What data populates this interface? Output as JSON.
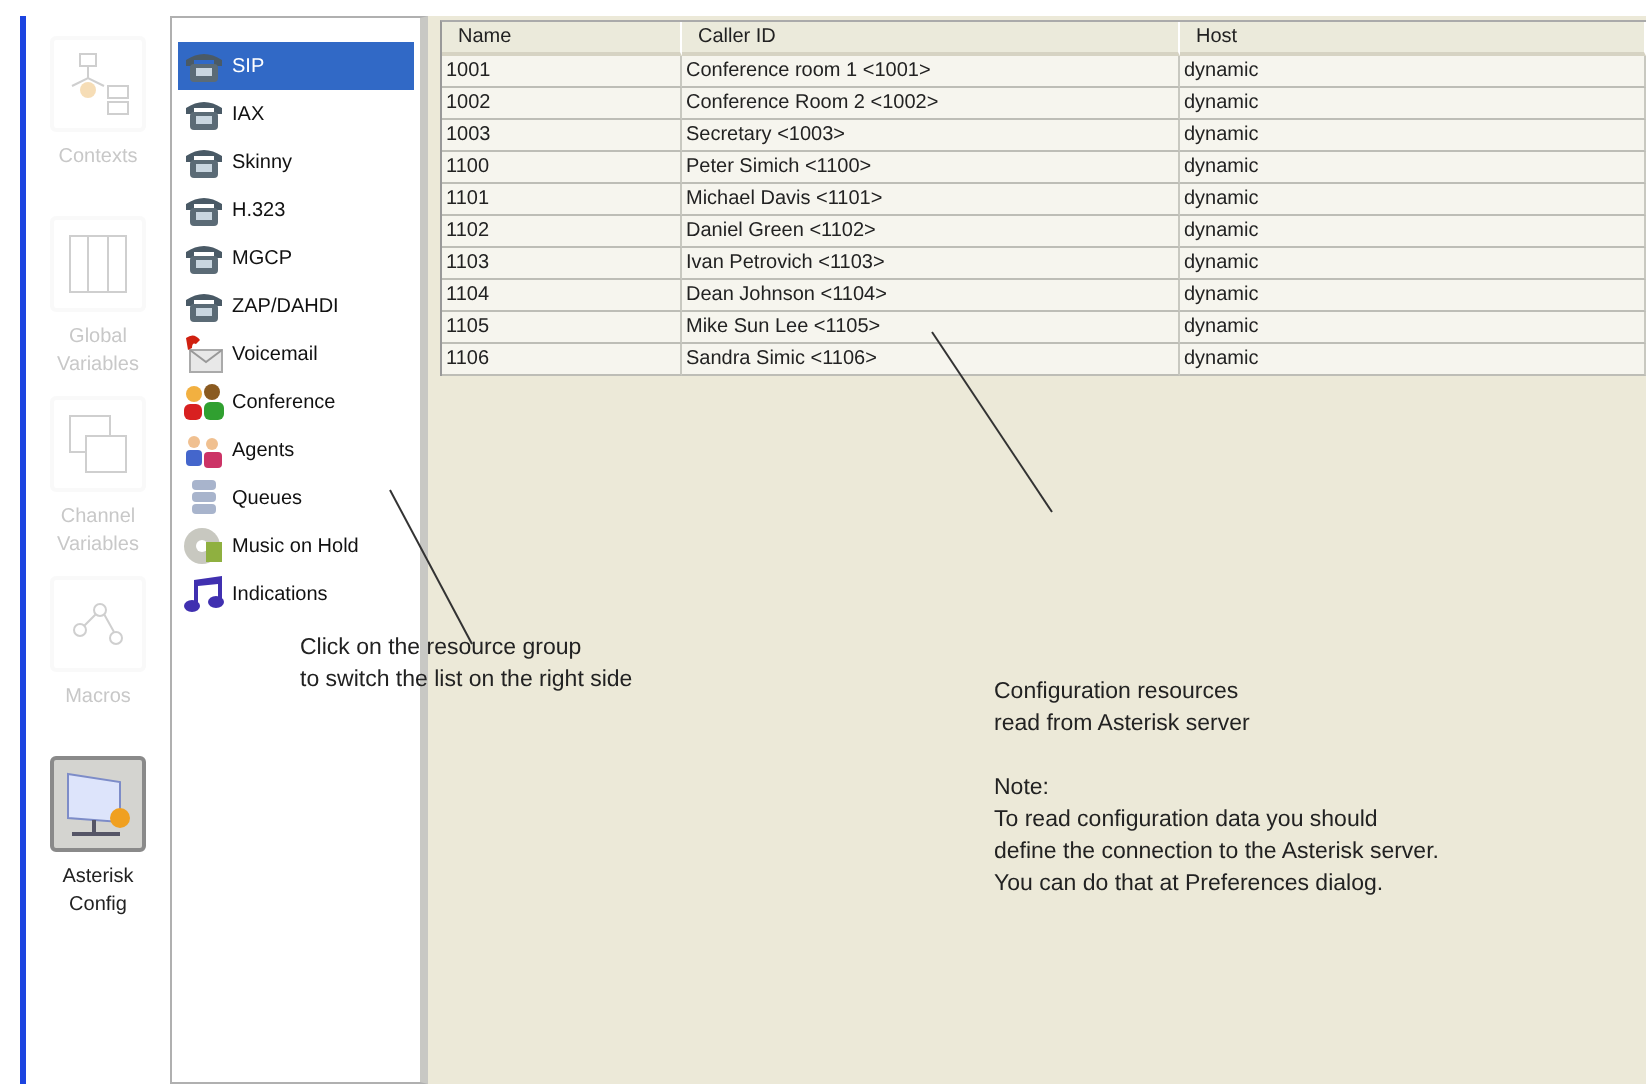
{
  "nav_items": [
    {
      "label": "Contexts",
      "kind": "contexts",
      "selected": false,
      "disabled": true
    },
    {
      "label": "Global Variables",
      "kind": "global",
      "selected": false,
      "disabled": true
    },
    {
      "label": "Channel Variables",
      "kind": "channel",
      "selected": false,
      "disabled": true
    },
    {
      "label": "Macros",
      "kind": "macros",
      "selected": false,
      "disabled": true
    },
    {
      "label": "Asterisk Config",
      "kind": "config",
      "selected": true,
      "disabled": false
    }
  ],
  "resource_groups": [
    {
      "label": "SIP",
      "kind": "phone",
      "selected": true
    },
    {
      "label": "IAX",
      "kind": "phone",
      "selected": false
    },
    {
      "label": "Skinny",
      "kind": "phone",
      "selected": false
    },
    {
      "label": "H.323",
      "kind": "phone",
      "selected": false
    },
    {
      "label": "MGCP",
      "kind": "phone",
      "selected": false
    },
    {
      "label": "ZAP/DAHDI",
      "kind": "phone",
      "selected": false
    },
    {
      "label": "Voicemail",
      "kind": "voicemail",
      "selected": false
    },
    {
      "label": "Conference",
      "kind": "conference",
      "selected": false
    },
    {
      "label": "Agents",
      "kind": "agents",
      "selected": false
    },
    {
      "label": "Queues",
      "kind": "queues",
      "selected": false
    },
    {
      "label": "Music on Hold",
      "kind": "music",
      "selected": false
    },
    {
      "label": "Indications",
      "kind": "indications",
      "selected": false
    }
  ],
  "table": {
    "columns": [
      "Name",
      "Caller ID",
      "Host"
    ],
    "rows": [
      [
        "1001",
        "Conference room 1 <1001>",
        "dynamic"
      ],
      [
        "1002",
        "Conference Room 2 <1002>",
        "dynamic"
      ],
      [
        "1003",
        "Secretary <1003>",
        "dynamic"
      ],
      [
        "1100",
        "Peter Simich <1100>",
        "dynamic"
      ],
      [
        "1101",
        "Michael Davis <1101>",
        "dynamic"
      ],
      [
        "1102",
        "Daniel Green <1102>",
        "dynamic"
      ],
      [
        "1103",
        "Ivan Petrovich <1103>",
        "dynamic"
      ],
      [
        "1104",
        "Dean Johnson <1104>",
        "dynamic"
      ],
      [
        "1105",
        "Mike Sun Lee <1105>",
        "dynamic"
      ],
      [
        "1106",
        "Sandra Simic <1106>",
        "dynamic"
      ]
    ]
  },
  "annotations": [
    {
      "paragraphs": [
        [
          "Click on the resource group",
          "to switch the list on the right side"
        ]
      ]
    },
    {
      "paragraphs": [
        [
          "Configuration resources",
          "read from Asterisk server"
        ],
        [
          "Note:",
          "To read configuration data you should",
          "define the connection to the Asterisk server.",
          "You can do that at Preferences dialog."
        ]
      ]
    }
  ]
}
